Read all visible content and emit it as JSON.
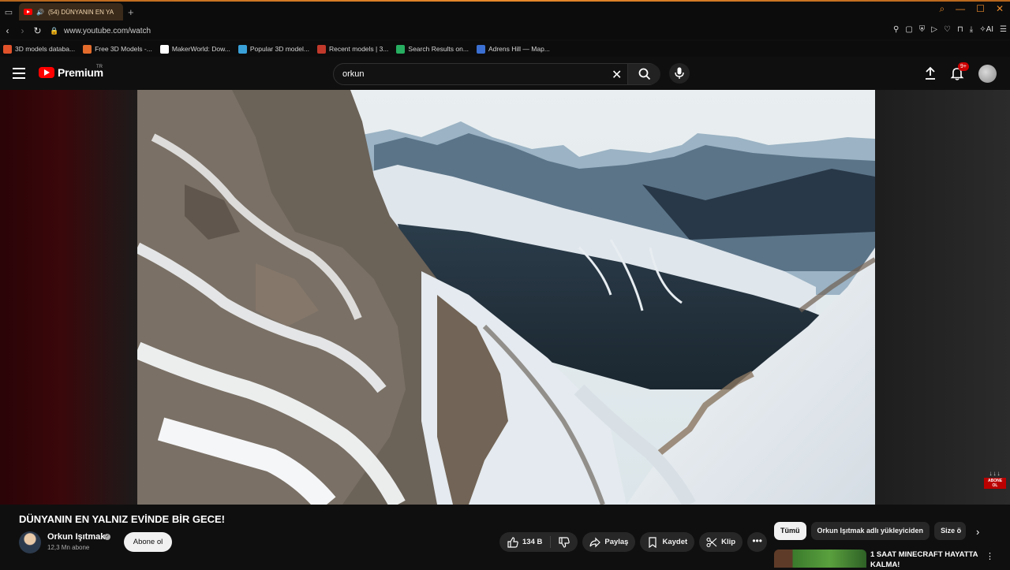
{
  "browser": {
    "tab_title": "(54) DÜNYANIN EN YA",
    "url": "www.youtube.com/watch",
    "bookmarks": [
      {
        "label": "3D models databa...",
        "color": "#e0522a"
      },
      {
        "label": "Free 3D Models -...",
        "color": "#e36b2b"
      },
      {
        "label": "MakerWorld: Dow...",
        "color": "#ffffff"
      },
      {
        "label": "Popular 3D model...",
        "color": "#3aa0d8"
      },
      {
        "label": "Recent models | 3...",
        "color": "#c0392b"
      },
      {
        "label": "Search Results on...",
        "color": "#27ae60"
      },
      {
        "label": "Adrens Hill — Map...",
        "color": "#3b6fd1"
      }
    ]
  },
  "header": {
    "logo_text": "Premium",
    "logo_region": "TR",
    "search_value": "orkun",
    "notification_count": "9+"
  },
  "video": {
    "watermark_text": "ABONE OL",
    "title": "DÜNYANIN EN YALNIZ EVİNDE BİR GECE!"
  },
  "channel": {
    "name": "Orkun Işıtmak",
    "subscribers": "12,3 Mn abone",
    "subscribe_label": "Abone ol"
  },
  "actions": {
    "like_count": "134 B",
    "share_label": "Paylaş",
    "save_label": "Kaydet",
    "clip_label": "Klip"
  },
  "chips": [
    "Tümü",
    "Orkun Işıtmak adlı yükleyiciden",
    "Size ö"
  ],
  "recommendation": {
    "title": "1 SAAT MINECRAFT HAYATTA KALMA!"
  },
  "colors": {
    "accent": "#ff0000",
    "browser_accent": "#e8892b",
    "background": "#0f0f0f"
  }
}
